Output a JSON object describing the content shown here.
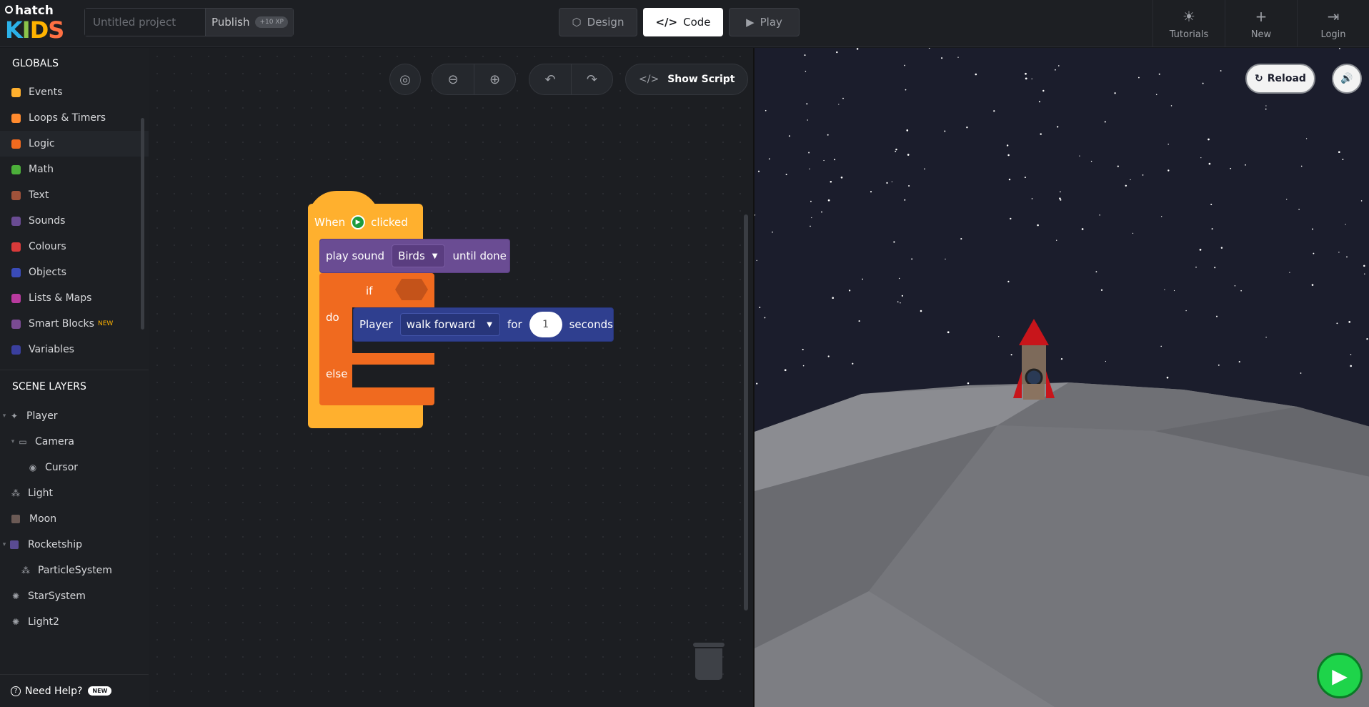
{
  "app": {
    "brand_top": "hatch",
    "brand_bottom": [
      "K",
      "I",
      "D",
      "S"
    ]
  },
  "header": {
    "project_placeholder": "Untitled project",
    "publish_label": "Publish",
    "publish_xp": "+10 XP",
    "modes": [
      {
        "label": "Design",
        "icon": "cube-icon"
      },
      {
        "label": "Code",
        "icon": "code-icon"
      },
      {
        "label": "Play",
        "icon": "play-icon"
      }
    ],
    "nav": [
      {
        "label": "Tutorials",
        "icon": "lightbulb-icon"
      },
      {
        "label": "New",
        "icon": "plus-icon"
      },
      {
        "label": "Login",
        "icon": "login-icon"
      }
    ]
  },
  "sidebar": {
    "globals_title": "GLOBALS",
    "categories": [
      {
        "label": "Events",
        "color": "#ffb02e"
      },
      {
        "label": "Loops & Timers",
        "color": "#ff8a2e"
      },
      {
        "label": "Logic",
        "color": "#f06a1f"
      },
      {
        "label": "Math",
        "color": "#4caf3a"
      },
      {
        "label": "Text",
        "color": "#a0523a"
      },
      {
        "label": "Sounds",
        "color": "#6a4c93"
      },
      {
        "label": "Colours",
        "color": "#d83a3a"
      },
      {
        "label": "Objects",
        "color": "#3a4bb8"
      },
      {
        "label": "Lists & Maps",
        "color": "#b83a9e"
      },
      {
        "label": "Smart Blocks",
        "color": "#7a4b93",
        "badge": "NEW"
      },
      {
        "label": "Variables",
        "color": "#3a3f9e"
      }
    ],
    "layers_title": "SCENE LAYERS",
    "layers": [
      {
        "label": "Player",
        "icon": "player-icon",
        "indent": 0,
        "caret": true
      },
      {
        "label": "Camera",
        "icon": "camera-icon",
        "indent": 1,
        "caret": true
      },
      {
        "label": "Cursor",
        "icon": "eye-icon",
        "indent": 2,
        "caret": false
      },
      {
        "label": "Light",
        "icon": "light-icon",
        "indent": 0,
        "caret": false
      },
      {
        "label": "Moon",
        "icon": "moon-icon",
        "indent": 0,
        "caret": false
      },
      {
        "label": "Rocketship",
        "icon": "rocket-icon",
        "indent": 0,
        "caret": true
      },
      {
        "label": "ParticleSystem",
        "icon": "particles-icon",
        "indent": 1,
        "caret": false
      },
      {
        "label": "StarSystem",
        "icon": "stars-icon",
        "indent": 0,
        "caret": false
      },
      {
        "label": "Light2",
        "icon": "light-icon",
        "indent": 0,
        "caret": false
      }
    ],
    "help_label": "Need Help?",
    "help_badge": "NEW"
  },
  "workspace": {
    "show_script_label": "Show Script",
    "blocks": {
      "when_label": "When",
      "clicked_label": "clicked",
      "play_sound_label": "play sound",
      "sound_value": "Birds",
      "until_done_label": "until done",
      "if_label": "if",
      "do_label": "do",
      "else_label": "else",
      "player_label": "Player",
      "action_value": "walk forward",
      "for_label": "for",
      "seconds_value": "1",
      "seconds_label": "seconds"
    }
  },
  "stage": {
    "reload_label": "Reload",
    "colors": {
      "sky": "#1b1d2c",
      "moon": "#7a7b80",
      "rocket": "#c8151b"
    }
  }
}
